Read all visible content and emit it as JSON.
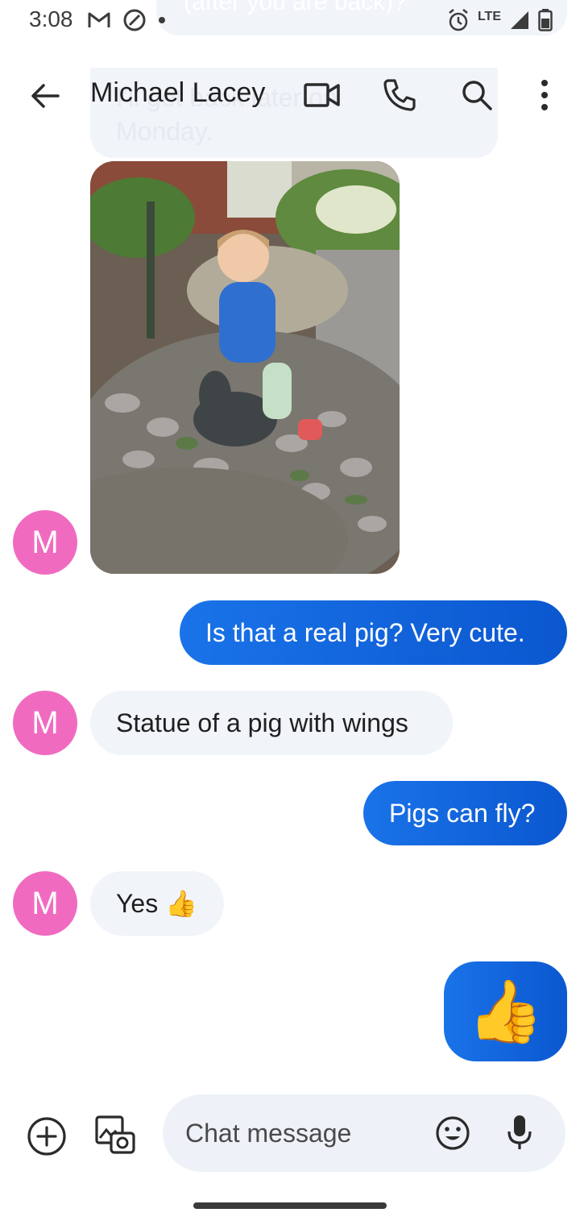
{
  "status_bar": {
    "time": "3:08",
    "network": "LTE"
  },
  "background_text": {
    "top": "(after you are back)?",
    "middle_line1": "I'll get back later on",
    "middle_line2": "Monday."
  },
  "header": {
    "contact_name": "Michael Lacey"
  },
  "messages": [
    {
      "direction": "incoming",
      "type": "photo",
      "avatar": "M"
    },
    {
      "direction": "outgoing",
      "text": "Is that a real pig? Very cute."
    },
    {
      "direction": "incoming",
      "text": "Statue of a pig with wings",
      "avatar": "M"
    },
    {
      "direction": "outgoing",
      "text": "Pigs can fly?"
    },
    {
      "direction": "incoming",
      "text": "Yes 👍",
      "avatar": "M"
    },
    {
      "direction": "outgoing",
      "text": "👍"
    }
  ],
  "compose": {
    "placeholder": "Chat message"
  },
  "colors": {
    "accent": "#0b57d0",
    "avatar": "#f06bc0",
    "incoming_bubble": "#f1f4f9"
  }
}
